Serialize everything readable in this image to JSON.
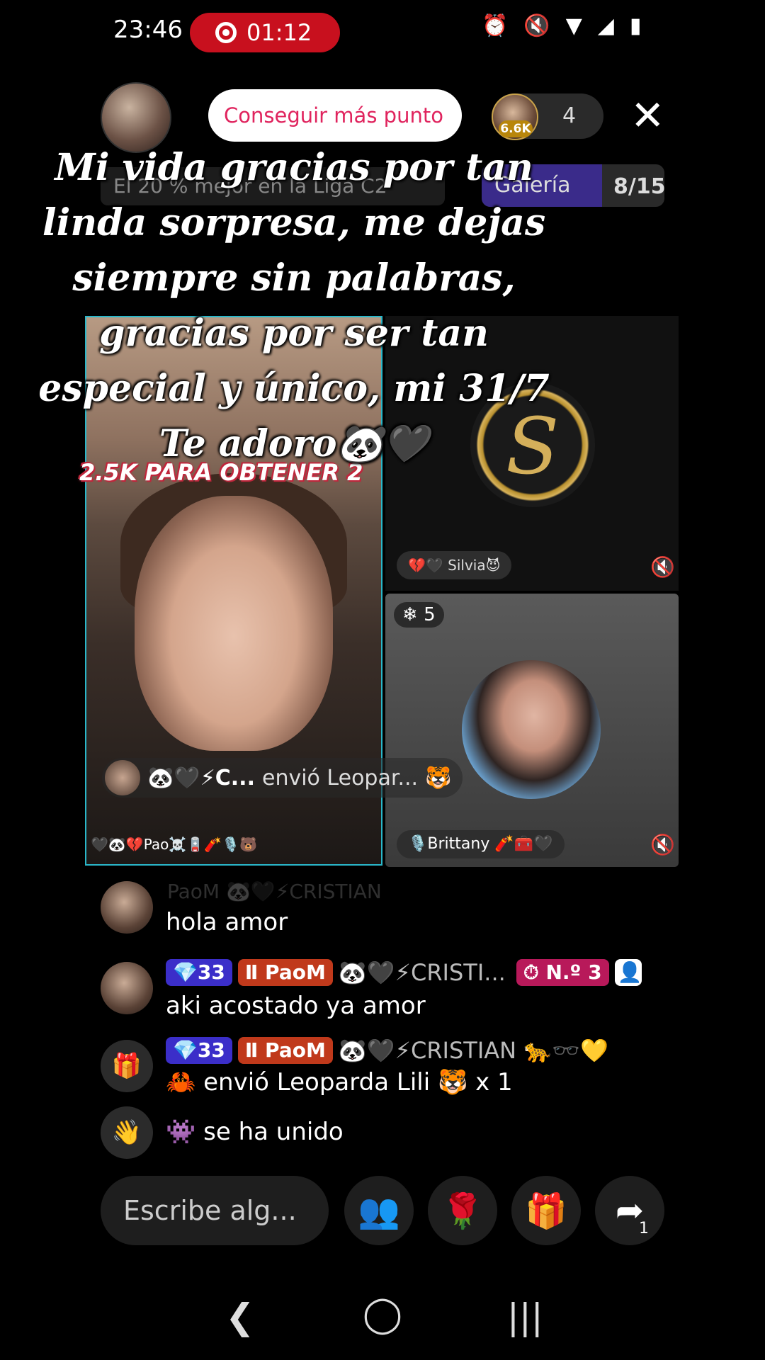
{
  "status_bar": {
    "time": "23:46",
    "recording": "01:12",
    "icons": [
      "alarm-icon",
      "mute-icon",
      "wifi-icon",
      "signal-icon",
      "battery-icon"
    ]
  },
  "top": {
    "points_button": "Conseguir más punto",
    "viewer_badge": "6.6K",
    "viewer_count": "4",
    "league_text": "El 20 % mejor en la Liga C2",
    "gallery_label": "Galería",
    "gallery_count": "8/15"
  },
  "caption": "Mi vida gracias por tan linda sorpresa, me dejas siempre sin palabras, gracias por ser tan especial y único, mi 31/7 Te adoro🐼🖤",
  "tiles": {
    "promo": "2.5K PARA OBTENER 2",
    "silvia_name": "💔🖤 Silvia😈",
    "ice_count": "5",
    "brittany_name": "🎙️Brittany 🧨🧰🖤",
    "pao_name": "🖤🐼💔Pao☠️🪫🧨🎙️🐻",
    "toast_user": "🐼🖤⚡C...",
    "toast_text": "envió  Leopar..."
  },
  "chat": {
    "faded_row": "PaoM  🐼🖤⚡CRISTIAN",
    "messages": [
      {
        "text": "hola amor"
      },
      {
        "level": "33",
        "fan": "PaoM",
        "user": "🐼🖤⚡CRISTI...",
        "rank": "N.º 3",
        "text": "aki acostado ya amor"
      },
      {
        "level": "33",
        "fan": "PaoM",
        "user": "🐼🖤⚡CRISTIAN 🐆🕶️💛",
        "text": "🦀 envió Leoparda Lili 🐯 x 1"
      },
      {
        "text": "👾 se ha unido"
      }
    ]
  },
  "bottom": {
    "input_placeholder": "Escribe alg...",
    "share_count": "1"
  }
}
